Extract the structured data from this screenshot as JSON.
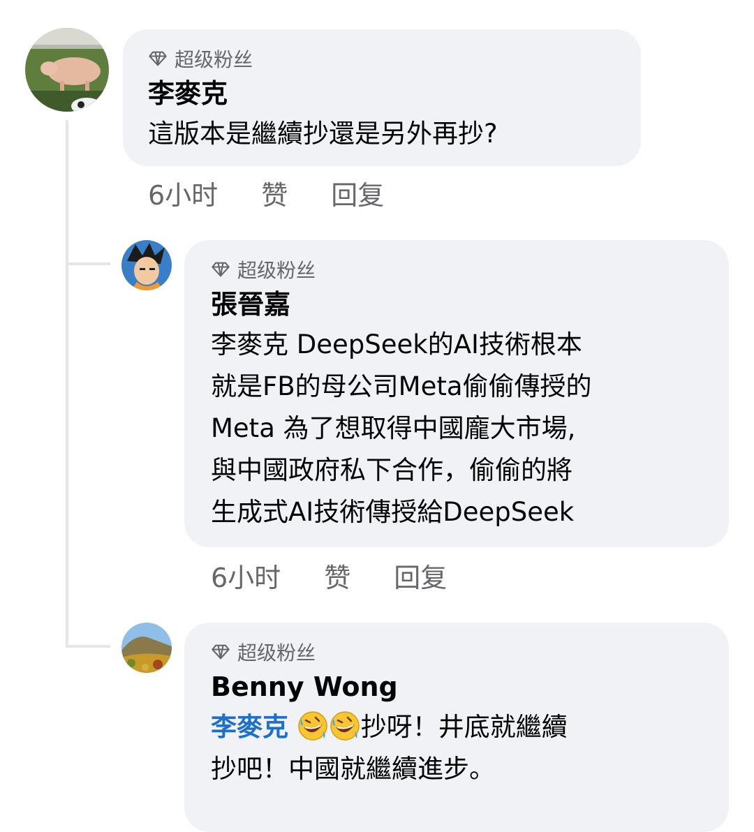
{
  "comments": [
    {
      "badge": "超级粉丝",
      "author": "李麥克",
      "text": "這版本是繼續抄還是另外再抄?",
      "time": "6小时",
      "like": "赞",
      "reply": "回复"
    },
    {
      "badge": "超级粉丝",
      "author": "張晉嘉",
      "lines": [
        "李麥克 DeepSeek的AI技術根本",
        "就是FB的母公司Meta偷偷傳授的",
        "Meta 為了想取得中國龐大市場,",
        "與中國政府私下合作，偷偷的將",
        "生成式AI技術傳授給DeepSeek"
      ],
      "time": "6小时",
      "like": "赞",
      "reply": "回复"
    },
    {
      "badge": "超级粉丝",
      "author": "Benny Wong",
      "mention": "李麥克",
      "emoji": "rolling-on-floor-laughing-emoji",
      "line1_rest": "抄呀！井底就繼續",
      "line2": "抄吧！中國就繼續進步。"
    }
  ],
  "colors": {
    "bubble": "#f0f2f5",
    "meta_text": "#65676b",
    "mention": "#1d6fc9",
    "thread_line": "#e4e6eb"
  }
}
